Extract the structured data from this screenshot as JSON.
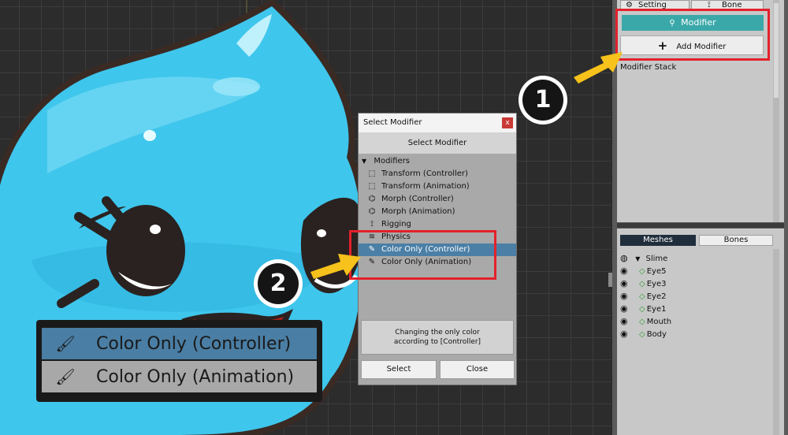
{
  "right_panel": {
    "setting_label": "Setting",
    "bone_label": "Bone",
    "modifier_tab_label": "Modifier",
    "add_modifier_label": "Add Modifier",
    "modifier_stack_label": "Modifier Stack",
    "meshes_tab_label": "Meshes",
    "bones_tab_label": "Bones",
    "root_item": "Slime",
    "mesh_items": [
      "Eye5",
      "Eye3",
      "Eye2",
      "Eye1",
      "Mouth",
      "Body"
    ]
  },
  "dialog": {
    "title": "Select Modifier",
    "close_glyph": "x",
    "header": "Select Modifier",
    "group_label": "Modifiers",
    "items": [
      {
        "label": "Transform (Controller)",
        "icon": "transform-icon"
      },
      {
        "label": "Transform (Animation)",
        "icon": "transform-icon"
      },
      {
        "label": "Morph (Controller)",
        "icon": "morph-icon"
      },
      {
        "label": "Morph (Animation)",
        "icon": "morph-icon"
      },
      {
        "label": "Rigging",
        "icon": "rigging-icon"
      },
      {
        "label": "Physics",
        "icon": "physics-icon"
      },
      {
        "label": "Color Only (Controller)",
        "icon": "color-brush-icon",
        "selected": true
      },
      {
        "label": "Color Only (Animation)",
        "icon": "color-brush-icon"
      }
    ],
    "description_line1": "Changing the only color",
    "description_line2": "according to [Controller]",
    "select_button": "Select",
    "close_button": "Close"
  },
  "callouts": {
    "first": "1",
    "second": "2"
  },
  "zoom_inset": {
    "row1": "Color Only (Controller)",
    "row2": "Color Only (Animation)"
  },
  "colors": {
    "accent_teal": "#3aa8a8",
    "selection_blue": "#4b7fa6",
    "highlight_red": "#e3212b",
    "arrow_yellow": "#f6c21b"
  }
}
